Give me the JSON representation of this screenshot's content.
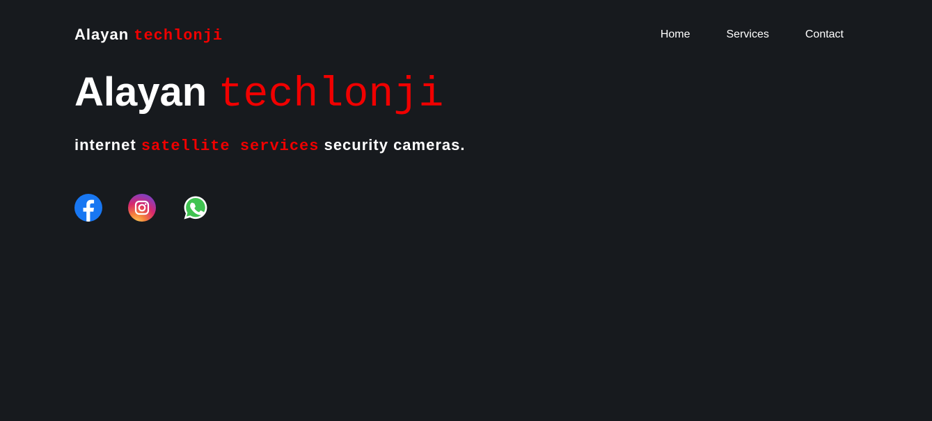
{
  "header": {
    "logo_main": "Alayan",
    "logo_accent": "techlonji",
    "nav": [
      {
        "label": "Home"
      },
      {
        "label": "Services"
      },
      {
        "label": "Contact"
      }
    ]
  },
  "hero": {
    "title_main": "Alayan",
    "title_accent": "techlonji",
    "tagline_part1": "internet",
    "tagline_accent": "satellite services",
    "tagline_part2": "security cameras."
  },
  "socials": [
    {
      "icon": "facebook-icon"
    },
    {
      "icon": "instagram-icon"
    },
    {
      "icon": "whatsapp-icon"
    }
  ],
  "colors": {
    "background": "#171a1e",
    "accent": "#f00000",
    "text": "#ffffff"
  }
}
